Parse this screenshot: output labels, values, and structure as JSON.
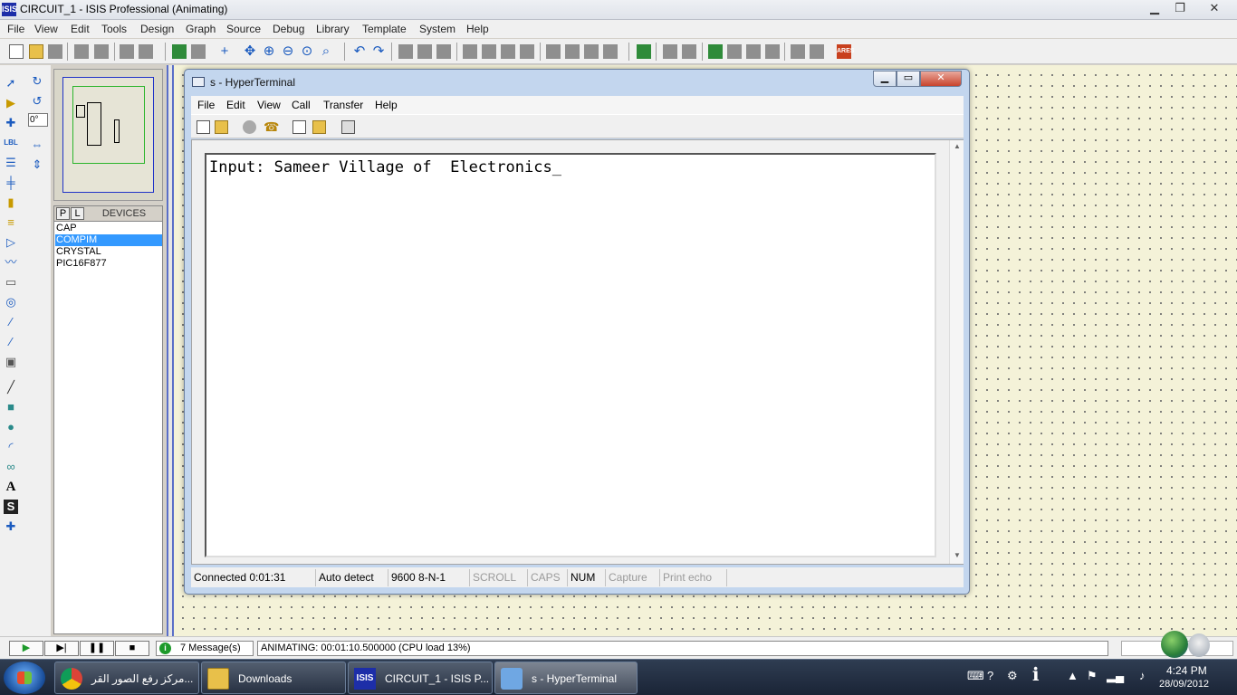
{
  "app": {
    "title": "CIRCUIT_1 - ISIS Professional (Animating)",
    "icon_text": "ISIS",
    "window_controls": {
      "minimize": "▁",
      "maximize": "❐",
      "close": "✕"
    }
  },
  "menu": [
    "File",
    "View",
    "Edit",
    "Tools",
    "Design",
    "Graph",
    "Source",
    "Debug",
    "Library",
    "Template",
    "System",
    "Help"
  ],
  "toolbar_icons": [
    "new-file-icon",
    "open-folder-icon",
    "save-icon",
    "import-icon",
    "export-icon",
    "print-icon",
    "print-setup-icon",
    "refresh-icon",
    "grid-icon",
    "origin-icon",
    "pan-icon",
    "zoom-in-icon",
    "zoom-out-icon",
    "zoom-all-icon",
    "zoom-area-icon",
    "undo-icon",
    "redo-icon",
    "cut-icon",
    "copy-icon",
    "paste-icon",
    "block-copy-icon",
    "block-move-icon",
    "block-rotate-icon",
    "block-delete-icon",
    "pick-device-icon",
    "make-device-icon",
    "packaging-icon",
    "decompose-icon",
    "wire-autorouter-icon",
    "search-icon",
    "property-tool-icon",
    "netlist-icon",
    "bom-icon",
    "erc-icon",
    "ares-icon"
  ],
  "left_tools": {
    "angle_value": "0°",
    "icons": [
      "select-icon",
      "component-icon",
      "junction-icon",
      "wire-label-icon",
      "text-script-icon",
      "bus-icon",
      "subcircuit-icon",
      "terminal-icon",
      "device-pin-icon",
      "graph-icon",
      "tape-recorder-icon",
      "generator-icon",
      "voltage-probe-icon",
      "current-probe-icon",
      "virtual-instrument-icon",
      "line-icon",
      "box-icon",
      "circle-icon",
      "arc-icon",
      "path-icon",
      "text-icon",
      "symbol-icon",
      "marker-icon",
      "rotate-cw-icon",
      "rotate-ccw-icon",
      "mirror-x-icon",
      "mirror-y-icon"
    ],
    "glyph_text": "A",
    "symbol_text": "S",
    "label_text": "LBL"
  },
  "device_panel": {
    "p_button": "P",
    "l_button": "L",
    "title": "DEVICES",
    "items": [
      {
        "name": "CAP",
        "selected": false
      },
      {
        "name": "COMPIM",
        "selected": true
      },
      {
        "name": "CRYSTAL",
        "selected": false
      },
      {
        "name": "PIC16F877",
        "selected": false
      }
    ]
  },
  "hyperterminal": {
    "title": "s - HyperTerminal",
    "controls": {
      "minimize": "▁",
      "maximize": "▭",
      "close": "✕"
    },
    "menu": [
      "File",
      "Edit",
      "View",
      "Call",
      "Transfer",
      "Help"
    ],
    "toolbar_icons": [
      "new-connection-icon",
      "open-icon",
      "disconnect-icon",
      "dial-icon",
      "send-icon",
      "receive-icon",
      "properties-icon"
    ],
    "terminal_text": "Input: Sameer Village of  Electronics_",
    "status": [
      {
        "text": "Connected 0:01:31",
        "dim": false
      },
      {
        "text": "Auto detect",
        "dim": false
      },
      {
        "text": "9600 8-N-1",
        "dim": false
      },
      {
        "text": "SCROLL",
        "dim": true
      },
      {
        "text": "CAPS",
        "dim": true
      },
      {
        "text": "NUM",
        "dim": false
      },
      {
        "text": "Capture",
        "dim": true
      },
      {
        "text": "Print echo",
        "dim": true
      }
    ]
  },
  "status_bar": {
    "play": "▶",
    "step": "▶|",
    "pause": "❚❚",
    "stop": "■",
    "messages": "7 Message(s)",
    "animation": "ANIMATING: 00:01:10.500000 (CPU load 13%)"
  },
  "taskbar": {
    "tasks": [
      {
        "label": "مركز رفع الصور القر...",
        "icon": "chrome-icon",
        "active": false
      },
      {
        "label": "Downloads",
        "icon": "folder-icon",
        "active": false
      },
      {
        "label": "CIRCUIT_1 - ISIS P...",
        "icon": "isis-icon",
        "active": false
      },
      {
        "label": "s - HyperTerminal",
        "icon": "hyperterminal-icon",
        "active": true
      }
    ],
    "tray_icons": [
      "keyboard-icon",
      "help-icon",
      "network-icon",
      "info-icon",
      "show-hidden-icon",
      "flag-icon",
      "signal-icon",
      "volume-icon"
    ],
    "time": "4:24 PM",
    "date": "28/09/2012"
  }
}
